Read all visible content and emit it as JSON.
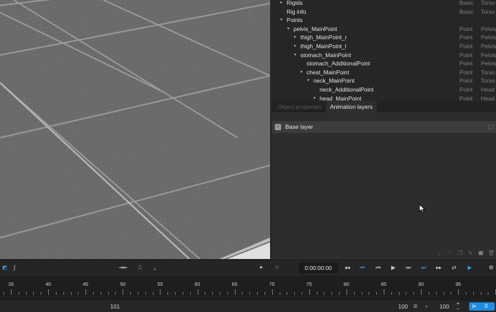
{
  "hierarchy": {
    "rows": [
      {
        "name": "Rigids",
        "type": "Basic",
        "part": "Torso",
        "arrow": "▸"
      },
      {
        "name": "Rig info",
        "type": "Basic",
        "part": "Torso",
        "arrow": ""
      },
      {
        "name": "Points",
        "type": "",
        "part": "",
        "arrow": "▾"
      },
      {
        "name": "pelvis_MainPoint",
        "type": "Point",
        "part": "Pelvis",
        "arrow": "▾"
      },
      {
        "name": "thigh_MainPoint_r",
        "type": "Point",
        "part": "Pelvis",
        "arrow": "▸"
      },
      {
        "name": "thigh_MainPoint_l",
        "type": "Point",
        "part": "Pelvis",
        "arrow": "▸"
      },
      {
        "name": "stomach_MainPoint",
        "type": "Point",
        "part": "Pelvis",
        "arrow": "▾"
      },
      {
        "name": "stomach_AdditionalPoint",
        "type": "Point",
        "part": "Pelvis",
        "arrow": ""
      },
      {
        "name": "chest_MainPoint",
        "type": "Point",
        "part": "Torso",
        "arrow": "▾"
      },
      {
        "name": "neck_MainPoint",
        "type": "Point",
        "part": "Torso",
        "arrow": "▾"
      },
      {
        "name": "neck_AdditionalPoint",
        "type": "Point",
        "part": "Head",
        "arrow": ""
      },
      {
        "name": "head_MainPoint",
        "type": "Point",
        "part": "Head",
        "arrow": "▾"
      }
    ]
  },
  "tabs": [
    {
      "label": "Object properties",
      "active": false
    },
    {
      "label": "Animation layers",
      "active": true
    }
  ],
  "layers": {
    "base_layer": "Base layer",
    "check": "✓"
  },
  "timeline": {
    "time": "0:00:00:00",
    "ruler_labels": [
      "35",
      "40",
      "45",
      "50",
      "55",
      "60",
      "65",
      "70",
      "75",
      "80",
      "85",
      "90",
      "95"
    ]
  },
  "bottom": {
    "current_frame": "101",
    "range_a": "100",
    "range_b": "100",
    "plus": "+",
    "minus": "−",
    "blue_value": "0"
  },
  "colors": {
    "accent_blue": "#1e8de0",
    "viewport_floor": "#6e6e6e"
  }
}
